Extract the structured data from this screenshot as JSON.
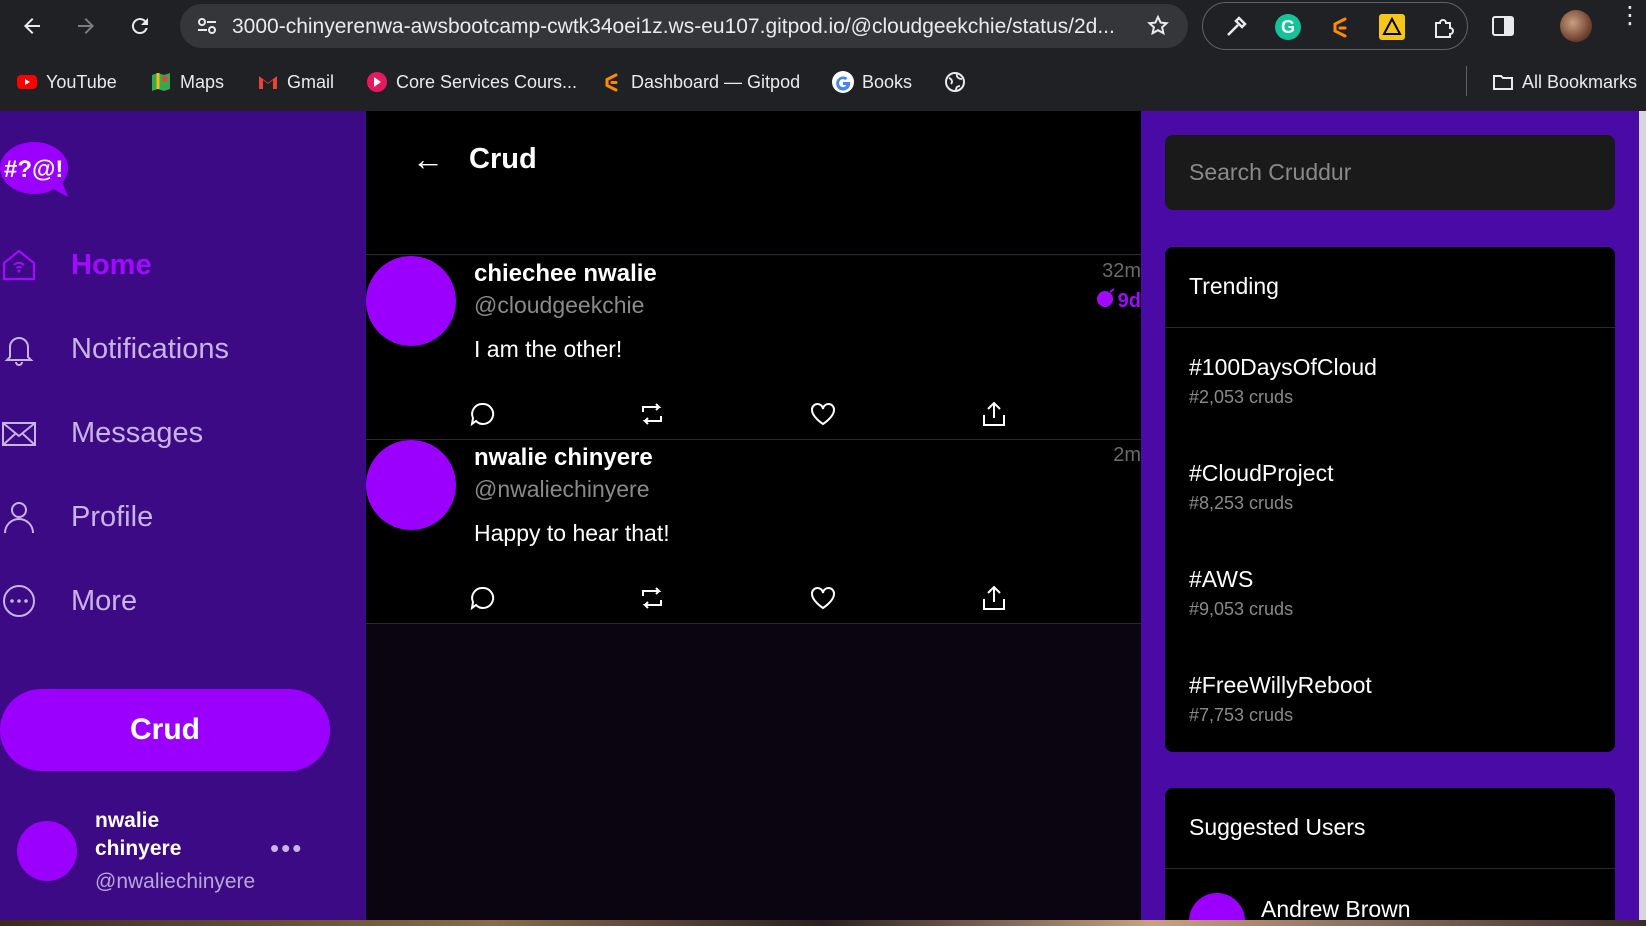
{
  "browser": {
    "url": "3000-chinyerenwa-awsbootcamp-cwtk34oei1z.ws-eu107.gitpod.io/@cloudgeekchie/status/2d...",
    "bookmarks": [
      {
        "label": "YouTube",
        "icon": "youtube-icon"
      },
      {
        "label": "Maps",
        "icon": "maps-icon"
      },
      {
        "label": "Gmail",
        "icon": "gmail-icon"
      },
      {
        "label": "Core Services Cours...",
        "icon": "course-icon"
      },
      {
        "label": "Dashboard — Gitpod",
        "icon": "gitpod-icon"
      },
      {
        "label": "Books",
        "icon": "google-icon"
      }
    ],
    "all_bookmarks": "All Bookmarks"
  },
  "sidebar": {
    "logo": "#?@!",
    "nav": [
      {
        "label": "Home",
        "icon": "home-icon",
        "active": true
      },
      {
        "label": "Notifications",
        "icon": "bell-icon",
        "active": false
      },
      {
        "label": "Messages",
        "icon": "mail-icon",
        "active": false
      },
      {
        "label": "Profile",
        "icon": "user-icon",
        "active": false
      },
      {
        "label": "More",
        "icon": "more-icon",
        "active": false
      }
    ],
    "crud_button": "Crud",
    "user": {
      "name": "nwalie chinyere",
      "handle": "@nwaliechinyere",
      "more": "•••"
    }
  },
  "main": {
    "back": "←",
    "title": "Crud",
    "posts": [
      {
        "name": "chiechee nwalie",
        "handle": "@cloudgeekchie",
        "text": "I am the other!",
        "time": "32m",
        "expires": "9d"
      },
      {
        "name": "nwalie chinyere",
        "handle": "@nwaliechinyere",
        "text": "Happy to hear that!",
        "time": "2m",
        "expires": ""
      }
    ]
  },
  "right": {
    "search_placeholder": "Search Cruddur",
    "trending_title": "Trending",
    "trending": [
      {
        "tag": "#100DaysOfCloud",
        "count": "#2,053 cruds"
      },
      {
        "tag": "#CloudProject",
        "count": "#8,253 cruds"
      },
      {
        "tag": "#AWS",
        "count": "#9,053 cruds"
      },
      {
        "tag": "#FreeWillyReboot",
        "count": "#7,753 cruds"
      }
    ],
    "suggested_title": "Suggested Users",
    "suggested": [
      {
        "name": "Andrew Brown"
      }
    ]
  },
  "colors": {
    "accent": "#9b00ff",
    "sidebar_bg": "#3d0a85",
    "right_bg": "#4a0aa6"
  }
}
